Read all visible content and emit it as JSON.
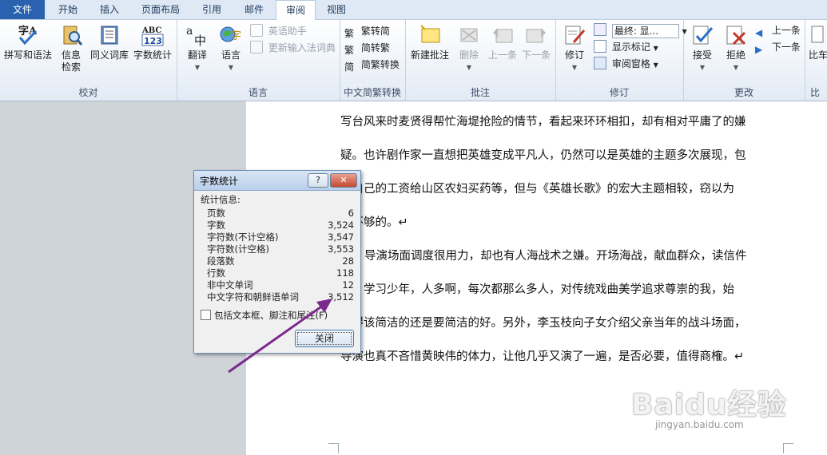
{
  "tabs": [
    {
      "label": "文件",
      "kind": "file"
    },
    {
      "label": "开始",
      "kind": "normal"
    },
    {
      "label": "插入",
      "kind": "normal"
    },
    {
      "label": "页面布局",
      "kind": "normal"
    },
    {
      "label": "引用",
      "kind": "normal"
    },
    {
      "label": "邮件",
      "kind": "normal"
    },
    {
      "label": "审阅",
      "kind": "active"
    },
    {
      "label": "视图",
      "kind": "normal"
    }
  ],
  "ribbon": {
    "proofing": {
      "label": "校对",
      "spelling": "拼写和语法",
      "research_1": "信息",
      "research_2": "检索",
      "thesaurus": "同义词库",
      "wordcount": "字数统计"
    },
    "language": {
      "label": "语言",
      "translate": "翻译",
      "language": "语言",
      "eng_assist": "英语助手",
      "update_ime": "更新输入法词典"
    },
    "chinese": {
      "label": "中文简繁转换",
      "t2s": "繁转简",
      "s2t": "简转繁",
      "convert": "简繁转换"
    },
    "comments": {
      "label": "批注",
      "new": "新建批注",
      "delete": "删除",
      "prev": "上一条",
      "next": "下一条"
    },
    "tracking": {
      "label": "修订",
      "track": "修订",
      "final": "最终: 显...",
      "show_markup": "显示标记",
      "review_pane": "审阅窗格"
    },
    "changes": {
      "label": "更改",
      "accept": "接受",
      "reject": "拒绝",
      "prev": "上一条",
      "next": "下一条"
    },
    "compare": {
      "label_short": "比",
      "btn_short": "比车"
    }
  },
  "document": {
    "lines": [
      "写台风来时麦贤得帮忙海堤抢险的情节，看起来环环相扣，却有相对平庸了的嫌",
      "疑。也许剧作家一直想把英雄变成平凡人，仍然可以是英雄的主题多次展现，包",
      "用自己的工资给山区农妇买药等，但与《英雄长歌》的宏大主题相较，窃以为",
      "是不够的。↵",
      "导演场面调度很用力，却也有人海战术之嫌。开场海战，献血群众，读信件",
      "年，学习少年，人多啊，每次都那么多人，对传统戏曲美学追求尊崇的我，始",
      "觉得该简洁的还是要简洁的好。另外，李玉枝向子女介绍父亲当年的战斗场面，",
      "导演也真不吝惜黄映伟的体力，让他几乎又演了一遍，是否必要，值得商榷。↵"
    ]
  },
  "dialog": {
    "title": "字数统计",
    "help": "?",
    "close_x": "✕",
    "stats_label": "统计信息:",
    "stats": [
      {
        "label": "页数",
        "value": "6"
      },
      {
        "label": "字数",
        "value": "3,524"
      },
      {
        "label": "字符数(不计空格)",
        "value": "3,547"
      },
      {
        "label": "字符数(计空格)",
        "value": "3,553"
      },
      {
        "label": "段落数",
        "value": "28"
      },
      {
        "label": "行数",
        "value": "118"
      },
      {
        "label": "非中文单词",
        "value": "12"
      },
      {
        "label": "中文字符和朝鲜语单词",
        "value": "3,512"
      }
    ],
    "include_label": "包括文本框、脚注和尾注(F)",
    "close_button": "关闭"
  },
  "watermark": {
    "text": "Baidu经验",
    "sub": "jingyan.baidu.com"
  },
  "colors": {
    "file_tab": "#2a62b0",
    "arrow": "#7b2a8c",
    "close": "#c44a31"
  }
}
